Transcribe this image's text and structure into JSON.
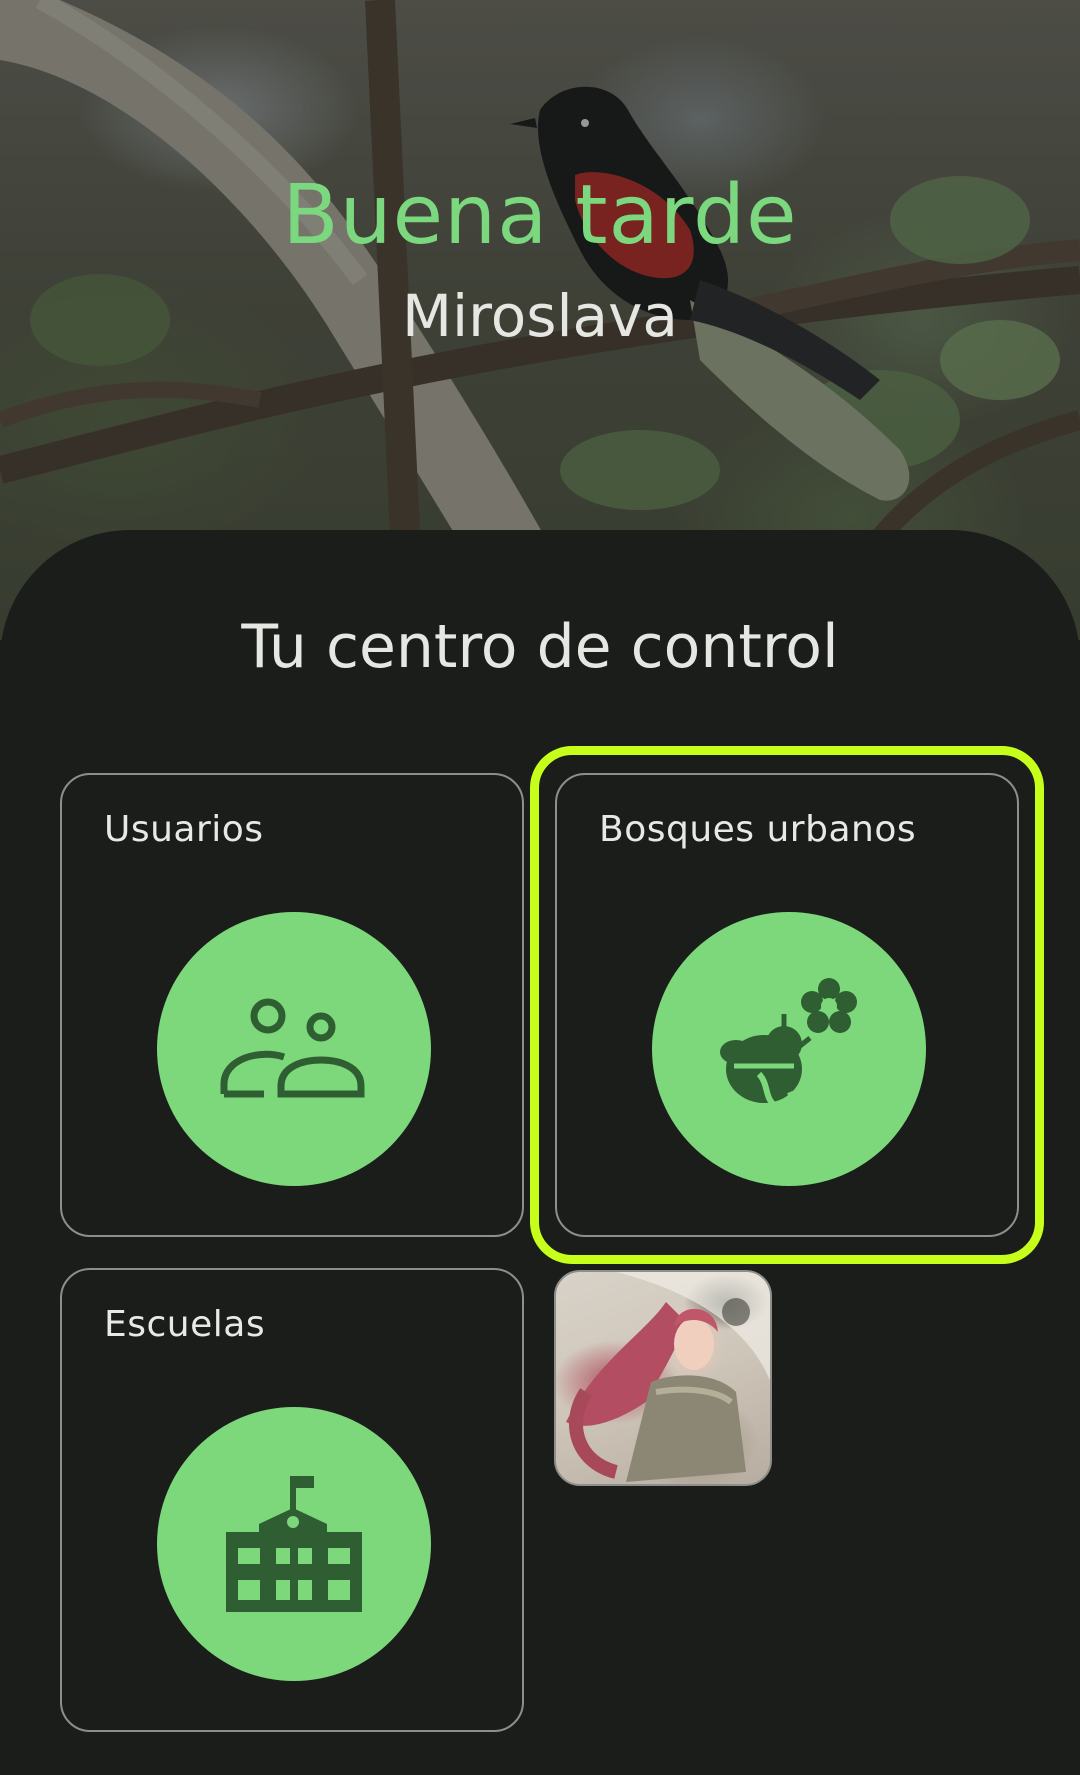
{
  "header": {
    "greeting": "Buena tarde",
    "username": "Miroslava"
  },
  "control_center": {
    "title": "Tu centro de control",
    "cards": [
      {
        "label": "Usuarios",
        "icon": "users-icon"
      },
      {
        "label": "Bosques urbanos",
        "icon": "bee-flower-icon"
      },
      {
        "label": "Escuelas",
        "icon": "school-icon"
      }
    ]
  },
  "colors": {
    "accent_green": "#7dd87c",
    "icon_dark_green": "#2e5e31",
    "highlight": "#c6ff1a",
    "background": "#1b1d1a",
    "greeting_green": "#7bd87e"
  }
}
